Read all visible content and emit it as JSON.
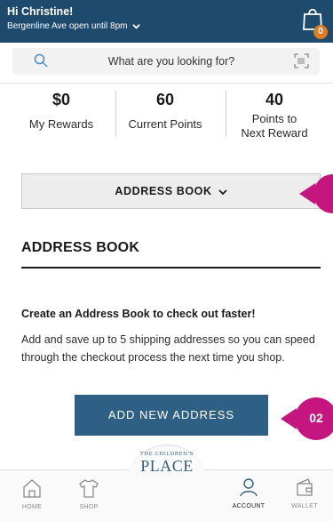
{
  "header": {
    "greeting": "Hi Christine!",
    "store_status": "Bergenline Ave open until 8pm",
    "bag_count": "0",
    "bar_color": "#1e4a6d",
    "badge_color": "#e07a23"
  },
  "search": {
    "placeholder": "What are you looking for?"
  },
  "stats": [
    {
      "value": "$0",
      "label": "My Rewards"
    },
    {
      "value": "60",
      "label": "Current Points"
    },
    {
      "value": "40",
      "label_line1": "Points to",
      "label_line2": "Next Reward"
    }
  ],
  "address_toggle": {
    "label": "ADDRESS BOOK"
  },
  "section": {
    "title": "ADDRESS BOOK",
    "headline": "Create an Address Book to check out faster!",
    "description": "Add and save up to 5 shipping addresses so you can speed through the checkout process the next time you shop."
  },
  "primary_button": {
    "label": "ADD NEW ADDRESS",
    "color": "#2e5f84"
  },
  "annotations": {
    "marker_2": "02",
    "marker_color": "#c4167e"
  },
  "nav": {
    "items": [
      {
        "label": "HOME",
        "icon": "home-icon"
      },
      {
        "label": "SHOP",
        "icon": "shirt-icon"
      },
      {
        "label": "ACCOUNT",
        "icon": "account-icon"
      },
      {
        "label": "WALLET",
        "icon": "wallet-icon"
      }
    ],
    "logo_line1": "THE CHILDREN'S",
    "logo_line2": "PLACE"
  }
}
